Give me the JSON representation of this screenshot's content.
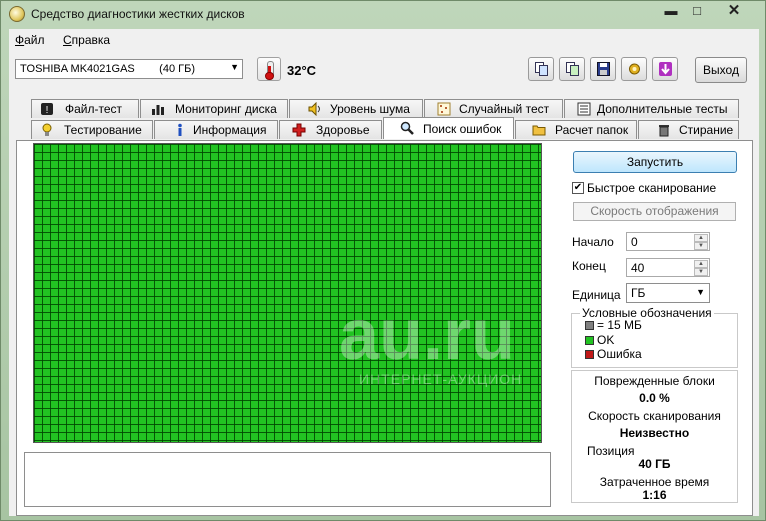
{
  "window": {
    "title": "Средство диагностики жестких дисков",
    "controls": {
      "minimize": "▬",
      "maximize": "□",
      "close": "✕"
    }
  },
  "menu": [
    {
      "label": "Файл",
      "accel": "Ф",
      "rest": "айл"
    },
    {
      "label": "Справка",
      "accel": "С",
      "rest": "правка"
    }
  ],
  "toolbar": {
    "disk_select": "TOSHIBA MK4021GAS        (40 ГБ)",
    "temperature": "32°C",
    "icons": [
      "copy-icon",
      "copy-report-icon",
      "save-icon",
      "settings-icon",
      "download-icon"
    ],
    "exit_label": "Выход"
  },
  "tabs": {
    "row_top": [
      {
        "label": "Файл-тест",
        "icon": "exclamation-icon"
      },
      {
        "label": "Мониторинг диска",
        "icon": "bar-chart-icon"
      },
      {
        "label": "Уровень шума",
        "icon": "speaker-icon"
      },
      {
        "label": "Случайный тест",
        "icon": "dots-icon"
      },
      {
        "label": "Дополнительные тесты",
        "icon": "checklist-icon"
      }
    ],
    "row_bottom": [
      {
        "label": "Тестирование",
        "icon": "lightbulb-icon"
      },
      {
        "label": "Информация",
        "icon": "info-icon"
      },
      {
        "label": "Здоровье",
        "icon": "health-cross-icon"
      },
      {
        "label": "Поиск ошибок",
        "icon": "magnifier-icon",
        "active": true
      },
      {
        "label": "Расчет папок",
        "icon": "folder-icon"
      },
      {
        "label": "Стирание",
        "icon": "trash-icon"
      }
    ]
  },
  "scan": {
    "run_label": "Запустить",
    "quick_scan_label": "Быстрое сканирование",
    "quick_scan_checked": true,
    "display_speed_label": "Скорость отображения",
    "start_label": "Начало",
    "start_value": "0",
    "end_label": "Конец",
    "end_value": "40",
    "unit_label": "Единица",
    "unit_value": "ГБ",
    "legend": {
      "title": "Условные обозначения",
      "items": [
        {
          "label": "= 15 МБ",
          "color": "#808080"
        },
        {
          "label": "OK",
          "color": "#22c322"
        },
        {
          "label": "Ошибка",
          "color": "#c01818"
        }
      ]
    },
    "stats": {
      "damaged_label": "Поврежденные блоки",
      "damaged_value": "0.0 %",
      "speed_label": "Скорость сканирования",
      "speed_value": "Неизвестно",
      "position_label": "Позиция",
      "position_value": "40 ГБ",
      "elapsed_label": "Затраченное время",
      "elapsed_value": "1:16"
    },
    "grid_status": "OK",
    "ok_color": "#22c322"
  },
  "watermark": {
    "main": "au.ru",
    "sub": "ИНТЕРНЕТ-АУКЦИОН"
  }
}
